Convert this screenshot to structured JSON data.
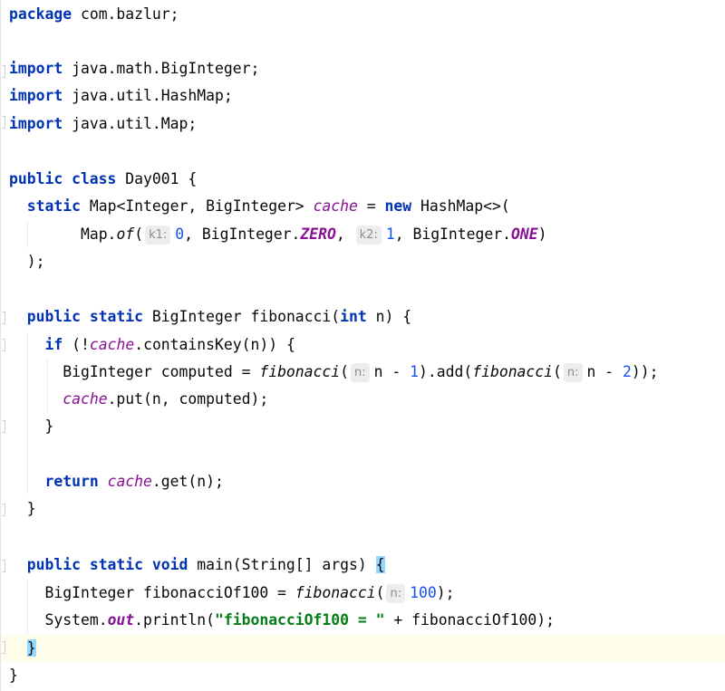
{
  "editor": {
    "package_kw": "package",
    "package_name": "com.bazlur;",
    "imports": [
      {
        "kw": "import",
        "path": "java.math.BigInteger;"
      },
      {
        "kw": "import",
        "path": "java.util.HashMap;"
      },
      {
        "kw": "import",
        "path": "java.util.Map;"
      }
    ],
    "class_decl": {
      "kw": "public class",
      "rest": "Day001 {"
    },
    "cache_decl": {
      "kw_static": "static",
      "type": "Map<Integer, BigInteger>",
      "name": "cache",
      "eq": "=",
      "kw_new": "new",
      "ctor": "HashMap<>("
    },
    "map_of": {
      "prefix": "Map.",
      "method": "of",
      "open": "(",
      "hint1": "k1:",
      "v1": "0",
      "sep1": ", BigInteger.",
      "c1": "ZERO",
      "sep2": ",",
      "hint2": "k2:",
      "v2": "1",
      "sep3": ", BigInteger.",
      "c2": "ONE",
      "close": ")"
    },
    "close_paren": ");",
    "fib_decl": {
      "kw": "public static",
      "rest": "BigInteger fibonacci(",
      "kw_int": "int",
      "rest2": "n) {"
    },
    "if_line": {
      "kw": "if",
      "pre": "(!",
      "field": "cache",
      "post": ".containsKey(n)) {"
    },
    "computed_line": {
      "pre": "BigInteger computed = ",
      "m1": "fibonacci",
      "open1": "(",
      "hint1": "n:",
      "arg1": "n - ",
      "num1": "1",
      "mid": ").add(",
      "m2": "fibonacci",
      "open2": "(",
      "hint2": "n:",
      "arg2": "n - ",
      "num2": "2",
      "end": "));"
    },
    "put_line": {
      "field": "cache",
      "rest": ".put(n, computed);"
    },
    "if_close": "}",
    "return_line": {
      "kw": "return",
      "field": "cache",
      "rest": ".get(n);"
    },
    "fib_close": "}",
    "main_decl": {
      "kw": "public static void",
      "rest": "main(String[] args)",
      "brace": "{"
    },
    "fib100_line": {
      "pre": "BigInteger fibonacciOf100 = ",
      "m": "fibonacci",
      "open": "(",
      "hint": "n:",
      "num": "100",
      "end": ");"
    },
    "println_line": {
      "pre": "System.",
      "field": "out",
      "mid": ".println(",
      "str": "\"fibonacciOf100 = \"",
      "end": " + fibonacciOf100);"
    },
    "main_close": "}",
    "class_close": "}"
  }
}
